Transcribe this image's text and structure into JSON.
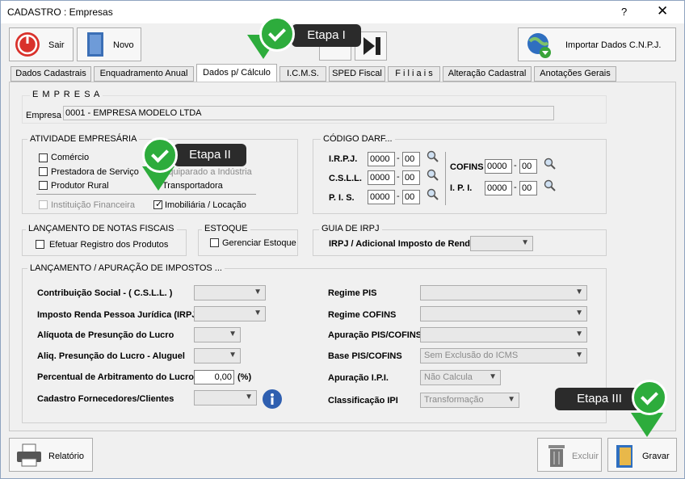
{
  "window": {
    "title": "CADASTRO : Empresas",
    "help": "?",
    "close": "✕"
  },
  "toolbar": {
    "sair": "Sair",
    "novo": "Novo",
    "importar": "Importar Dados C.N.P.J."
  },
  "tabs": [
    "Dados Cadastrais",
    "Enquadramento Anual",
    "Dados p/ Cálculo",
    "I.C.M.S.",
    "SPED Fiscal",
    "F i l i a i s",
    "Alteração Cadastral",
    "Anotações Gerais"
  ],
  "empresa": {
    "group": "E M P R E S A",
    "label": "Empresa",
    "value": "0001 - EMPRESA MODELO LTDA"
  },
  "atividade": {
    "title": "ATIVIDADE EMPRESÁRIA",
    "comercio": "Comércio",
    "prestadora": "Prestadora de Serviço",
    "produtor": "Produtor Rural",
    "instituicao": "Instituição Financeira",
    "equiparado": "Equiparado a Indústria",
    "transportadora": "Transportadora",
    "imobiliaria": "Imobiliária / Locação"
  },
  "darf": {
    "title": "CÓDIGO DARF...",
    "irpj": "I.R.P.J.",
    "csll": "C.S.L.L.",
    "pis": "P. I. S.",
    "cofins": "COFINS",
    "ipi": "I. P. I.",
    "code": "0000",
    "sub": "00",
    "dash": "-"
  },
  "notas": {
    "title": "LANÇAMENTO DE NOTAS FISCAIS",
    "efetuar": "Efetuar Registro dos Produtos"
  },
  "estoque": {
    "title": "ESTOQUE",
    "gerenciar": "Gerenciar Estoque"
  },
  "guia": {
    "title": "GUIA DE IRPJ",
    "label": "IRPJ / Adicional Imposto de Renda"
  },
  "impostos": {
    "title": "LANÇAMENTO / APURAÇÃO DE IMPOSTOS ...",
    "contrib": "Contribuição Social - ( C.S.L.L. )",
    "irpj": "Imposto Renda Pessoa Jurídica (IRPJ)",
    "aliquota": "Alíquota de Presunção do Lucro",
    "aliq_aluguel": "Aliq. Presunção do Lucro - Aluguel",
    "percentual": "Percentual de Arbitramento do Lucro",
    "percentual_value": "0,00",
    "percent_unit": "(%)",
    "cadastro": "Cadastro Fornecedores/Clientes",
    "regime_pis": "Regime PIS",
    "regime_cofins": "Regime COFINS",
    "apuracao_pis": "Apuração PIS/COFINS",
    "base_pis": "Base PIS/COFINS",
    "base_value": "Sem Exclusão do ICMS",
    "apuracao_ipi": "Apuração I.P.I.",
    "apuracao_ipi_value": "Não Calcula",
    "classificacao": "Classificação IPI",
    "classificacao_value": "Transformação"
  },
  "footer": {
    "relatorio": "Relatório",
    "excluir": "Excluir",
    "gravar": "Gravar"
  },
  "badges": {
    "etapa1": "Etapa I",
    "etapa2": "Etapa II",
    "etapa3": "Etapa III"
  },
  "colors": {
    "accent_green": "#2dac3c",
    "badge_bg": "#2b2b2b"
  }
}
